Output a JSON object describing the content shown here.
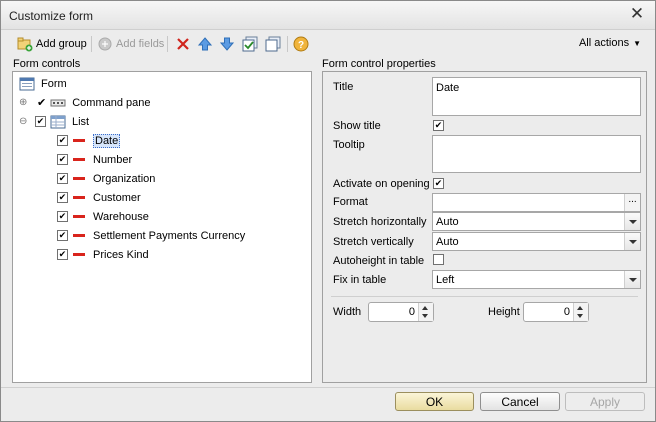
{
  "window": {
    "title": "Customize form"
  },
  "toolbar": {
    "add_group": "Add group",
    "add_fields": "Add fields",
    "all_actions": "All actions"
  },
  "left": {
    "label": "Form controls",
    "root": "Form",
    "command_pane": "Command pane",
    "list": "List",
    "items": [
      "Date",
      "Number",
      "Organization",
      "Customer",
      "Warehouse",
      "Settlement Payments Currency",
      "Prices Kind"
    ]
  },
  "right": {
    "label": "Form control properties",
    "title_label": "Title",
    "title_value": "Date",
    "show_title": "Show title",
    "tooltip": "Tooltip",
    "activate_on_opening": "Activate on opening",
    "format": "Format",
    "stretch_h": "Stretch horizontally",
    "stretch_h_value": "Auto",
    "stretch_v": "Stretch vertically",
    "stretch_v_value": "Auto",
    "autoheight": "Autoheight in table",
    "fix_in_table": "Fix in table",
    "fix_in_table_value": "Left",
    "width_label": "Width",
    "width_value": "0",
    "height_label": "Height",
    "height_value": "0",
    "format_btn": "..."
  },
  "buttons": {
    "ok": "OK",
    "cancel": "Cancel",
    "apply": "Apply"
  }
}
